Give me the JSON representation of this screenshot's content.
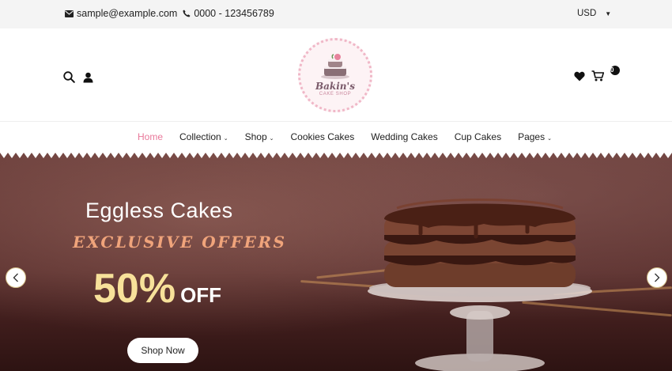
{
  "topbar": {
    "email": "sample@example.com",
    "phone": "0000 - 123456789",
    "currency": "USD"
  },
  "header": {
    "logo_brand": "Bakin's",
    "logo_tag": "CAKE SHOP",
    "cart_count": "0"
  },
  "nav": {
    "items": [
      {
        "label": "Home"
      },
      {
        "label": "Collection"
      },
      {
        "label": "Shop"
      },
      {
        "label": "Cookies Cakes"
      },
      {
        "label": "Wedding Cakes"
      },
      {
        "label": "Cup Cakes"
      },
      {
        "label": "Pages"
      }
    ]
  },
  "hero": {
    "title": "Eggless Cakes",
    "subtitle": "EXCLUSIVE OFFERS",
    "discount_value": "50%",
    "discount_suffix": "OFF",
    "button_label": "Shop Now"
  },
  "icons": {
    "email": "envelope-icon",
    "phone": "phone-icon",
    "search": "search-icon",
    "user": "user-icon",
    "wishlist": "heart-icon",
    "cart": "cart-icon",
    "prev": "chevron-left-icon",
    "next": "chevron-right-icon"
  },
  "colors": {
    "accent": "#e9789a",
    "hero_subtitle": "#f0a47b",
    "hero_discount": "#f7e19a"
  }
}
